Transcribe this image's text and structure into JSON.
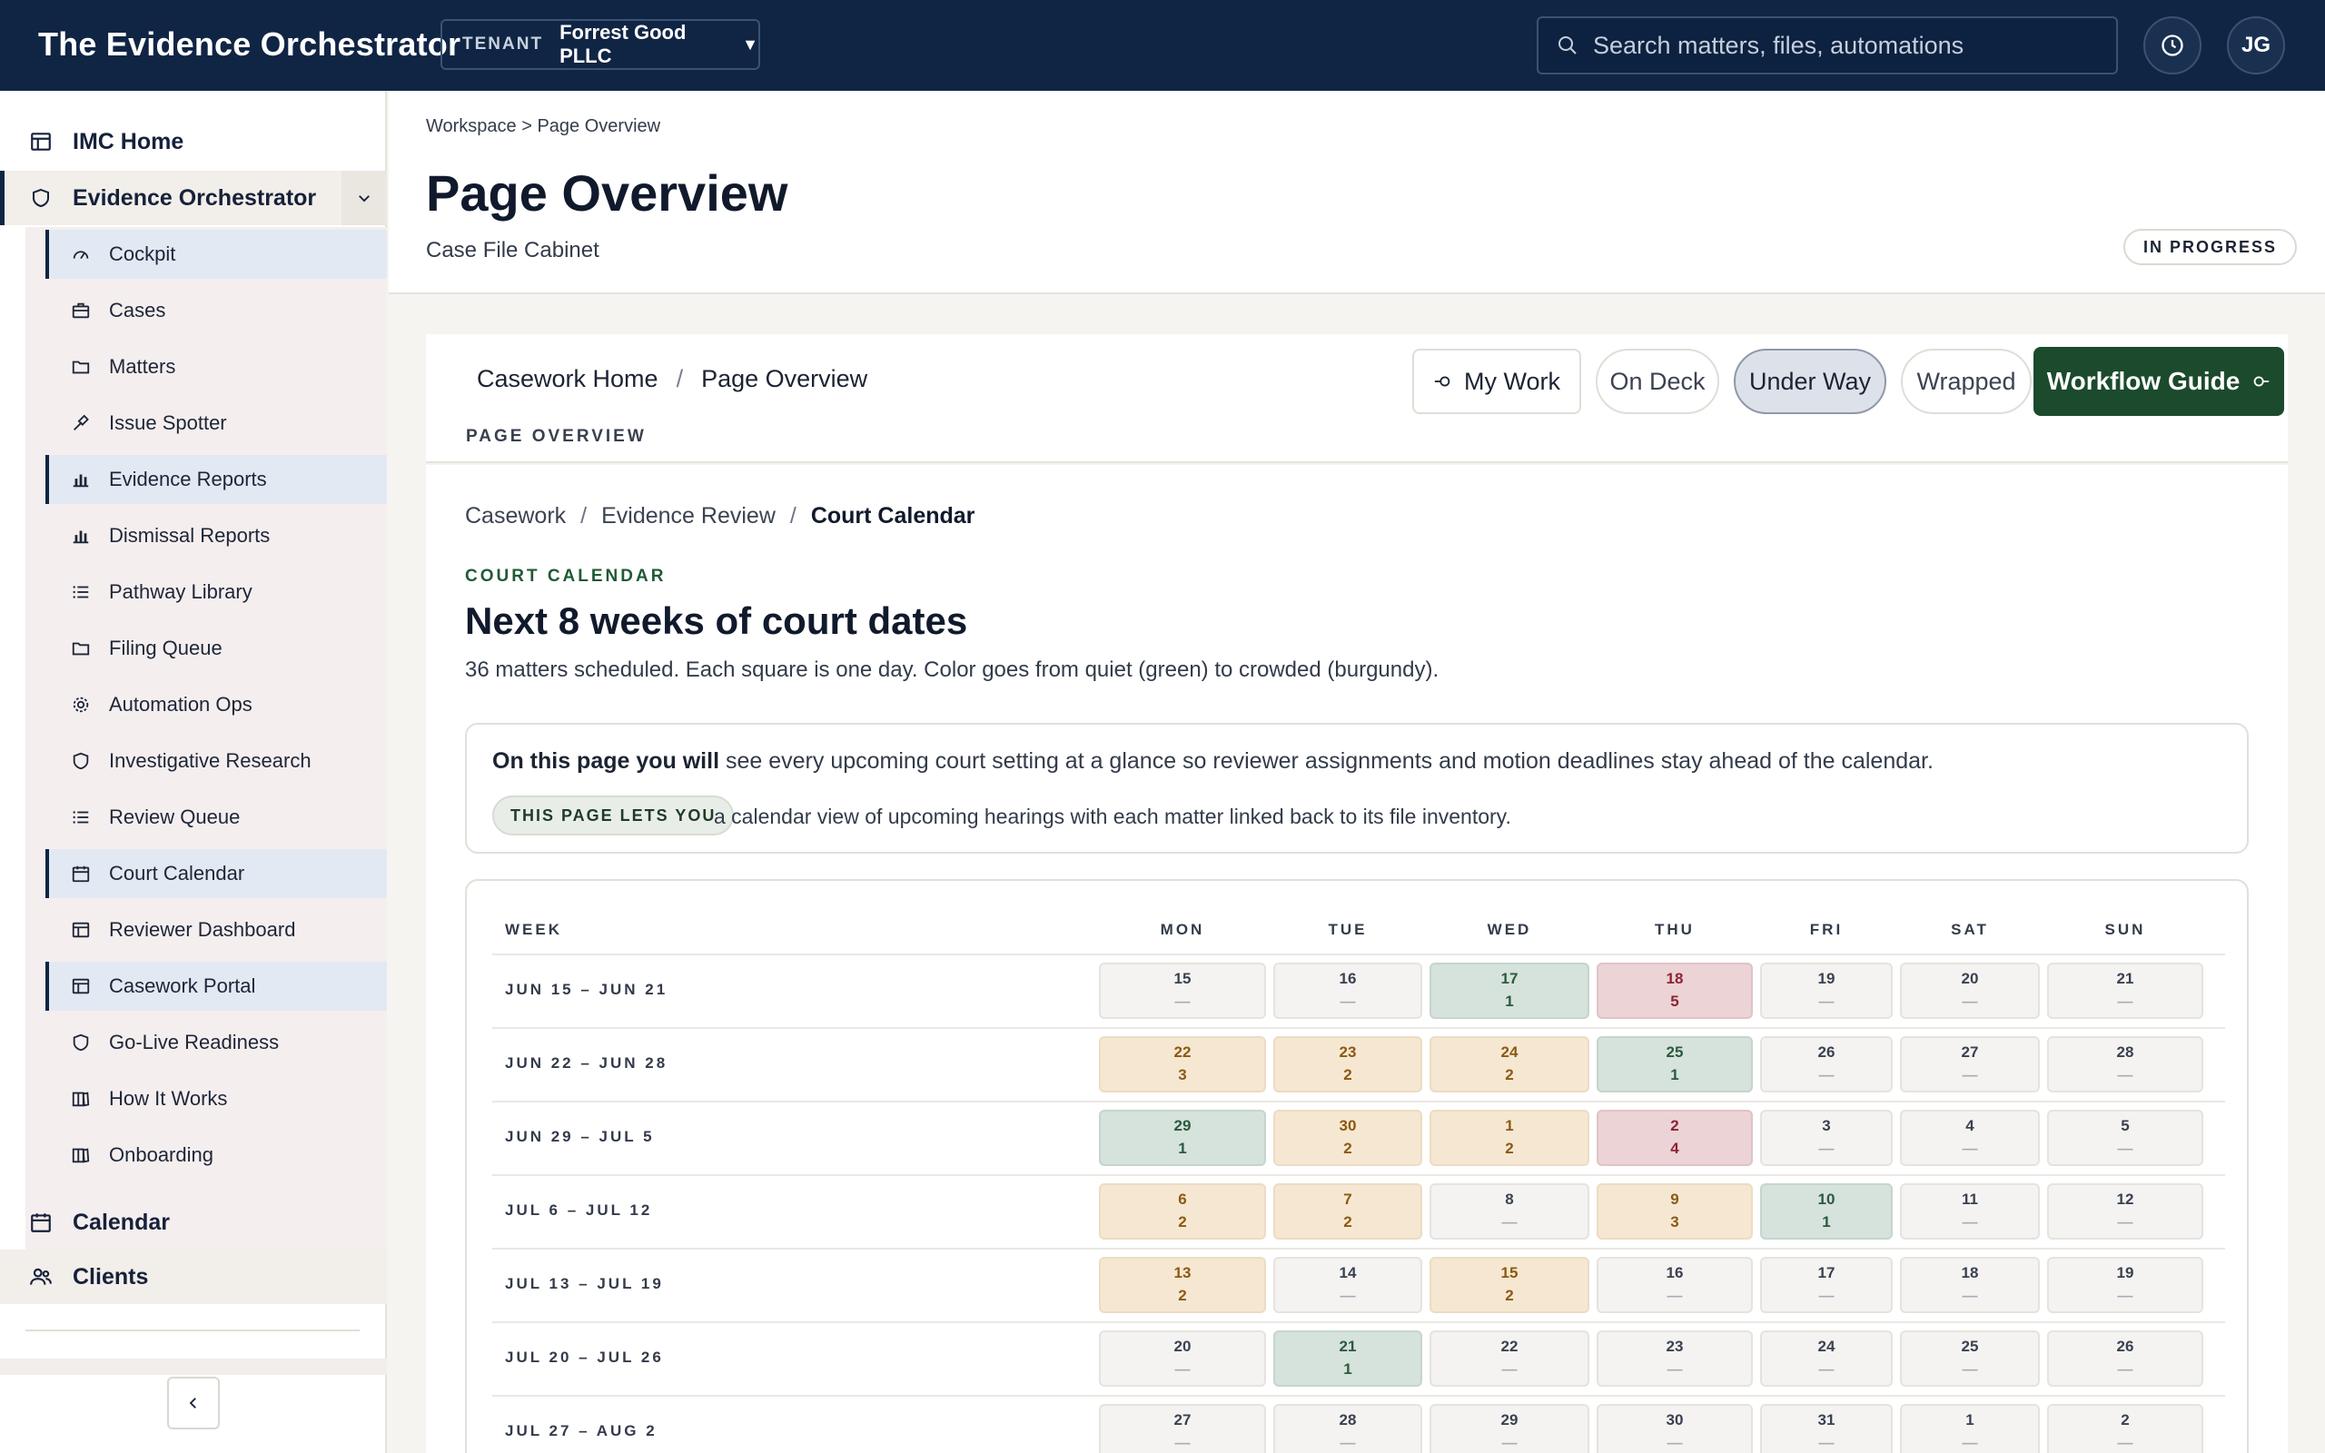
{
  "topbar": {
    "brand": "The Evidence Orchestrator",
    "tenant_label": "TENANT",
    "tenant_value": "Forrest Good PLLC",
    "search_placeholder": "Search matters, files, automations",
    "avatar_initials": "JG"
  },
  "sidebar": {
    "home": "IMC Home",
    "section": "Evidence Orchestrator",
    "items": [
      {
        "label": "Cockpit",
        "icon": "gauge-icon",
        "active": true
      },
      {
        "label": "Cases",
        "icon": "briefcase-icon",
        "active": false
      },
      {
        "label": "Matters",
        "icon": "folder-icon",
        "active": false
      },
      {
        "label": "Issue Spotter",
        "icon": "gavel-icon",
        "active": false
      },
      {
        "label": "Evidence Reports",
        "icon": "bar-chart-icon",
        "active": true
      },
      {
        "label": "Dismissal Reports",
        "icon": "bar-chart-icon",
        "active": false
      },
      {
        "label": "Pathway Library",
        "icon": "list-icon",
        "active": false
      },
      {
        "label": "Filing Queue",
        "icon": "folder-icon",
        "active": false
      },
      {
        "label": "Automation Ops",
        "icon": "gear-icon",
        "active": false
      },
      {
        "label": "Investigative Research",
        "icon": "shield-icon",
        "active": false
      },
      {
        "label": "Review Queue",
        "icon": "list-icon",
        "active": false
      },
      {
        "label": "Court Calendar",
        "icon": "calendar-icon",
        "active": true
      },
      {
        "label": "Reviewer Dashboard",
        "icon": "layout-icon",
        "active": false
      },
      {
        "label": "Casework Portal",
        "icon": "layout-icon",
        "active": true
      },
      {
        "label": "Go-Live Readiness",
        "icon": "shield-icon",
        "active": false
      },
      {
        "label": "How It Works",
        "icon": "book-icon",
        "active": false
      },
      {
        "label": "Onboarding",
        "icon": "book-icon",
        "active": false
      }
    ],
    "calendar": "Calendar",
    "clients": "Clients"
  },
  "header": {
    "breadcrumb": "Workspace > Page Overview",
    "title": "Page Overview",
    "subtitle": "Case File Cabinet",
    "status": "IN PROGRESS"
  },
  "toolbar": {
    "crumb_home": "Casework Home",
    "crumb_sep": "/",
    "crumb_current": "Page Overview",
    "section_label": "PAGE OVERVIEW",
    "filters": {
      "my_work": "My Work",
      "on_deck": "On Deck",
      "under_way": "Under Way",
      "wrapped": "Wrapped"
    },
    "guide_button": "Workflow Guide"
  },
  "content": {
    "crumbs": [
      "Casework",
      "Evidence Review",
      "Court Calendar"
    ],
    "eyebrow": "COURT CALENDAR",
    "heading": "Next 8 weeks of court dates",
    "description": "36 matters scheduled. Each square is one day. Color goes from quiet (green) to crowded (burgundy).",
    "info": {
      "lead_bold": "On this page you will",
      "lead_rest": "see every upcoming court setting at a glance so reviewer assignments and motion deadlines stay ahead of the calendar.",
      "chip": "THIS PAGE LETS YOU",
      "detail": "a calendar view of upcoming hearings with each matter linked back to its file inventory."
    }
  },
  "calendar": {
    "week_header": "WEEK",
    "days": [
      "MON",
      "TUE",
      "WED",
      "THU",
      "FRI",
      "SAT",
      "SUN"
    ],
    "empty_mark": "—",
    "weeks": [
      {
        "label": "JUN 15 – JUN 21",
        "cells": [
          {
            "d": "15",
            "n": 0
          },
          {
            "d": "16",
            "n": 0
          },
          {
            "d": "17",
            "n": 1
          },
          {
            "d": "18",
            "n": 5
          },
          {
            "d": "19",
            "n": 0
          },
          {
            "d": "20",
            "n": 0
          },
          {
            "d": "21",
            "n": 0
          }
        ]
      },
      {
        "label": "JUN 22 – JUN 28",
        "cells": [
          {
            "d": "22",
            "n": 3
          },
          {
            "d": "23",
            "n": 2
          },
          {
            "d": "24",
            "n": 2
          },
          {
            "d": "25",
            "n": 1
          },
          {
            "d": "26",
            "n": 0
          },
          {
            "d": "27",
            "n": 0
          },
          {
            "d": "28",
            "n": 0
          }
        ]
      },
      {
        "label": "JUN 29 – JUL 5",
        "cells": [
          {
            "d": "29",
            "n": 1
          },
          {
            "d": "30",
            "n": 2
          },
          {
            "d": "1",
            "n": 2
          },
          {
            "d": "2",
            "n": 4
          },
          {
            "d": "3",
            "n": 0
          },
          {
            "d": "4",
            "n": 0
          },
          {
            "d": "5",
            "n": 0
          }
        ]
      },
      {
        "label": "JUL 6 – JUL 12",
        "cells": [
          {
            "d": "6",
            "n": 2
          },
          {
            "d": "7",
            "n": 2
          },
          {
            "d": "8",
            "n": 0
          },
          {
            "d": "9",
            "n": 3
          },
          {
            "d": "10",
            "n": 1
          },
          {
            "d": "11",
            "n": 0
          },
          {
            "d": "12",
            "n": 0
          }
        ]
      },
      {
        "label": "JUL 13 – JUL 19",
        "cells": [
          {
            "d": "13",
            "n": 2
          },
          {
            "d": "14",
            "n": 0
          },
          {
            "d": "15",
            "n": 2
          },
          {
            "d": "16",
            "n": 0
          },
          {
            "d": "17",
            "n": 0
          },
          {
            "d": "18",
            "n": 0
          },
          {
            "d": "19",
            "n": 0
          }
        ]
      },
      {
        "label": "JUL 20 – JUL 26",
        "cells": [
          {
            "d": "20",
            "n": 0
          },
          {
            "d": "21",
            "n": 1
          },
          {
            "d": "22",
            "n": 0
          },
          {
            "d": "23",
            "n": 0
          },
          {
            "d": "24",
            "n": 0
          },
          {
            "d": "25",
            "n": 0
          },
          {
            "d": "26",
            "n": 0
          }
        ]
      },
      {
        "label": "JUL 27 – AUG 2",
        "cells": [
          {
            "d": "27",
            "n": 0
          },
          {
            "d": "28",
            "n": 0
          },
          {
            "d": "29",
            "n": 0
          },
          {
            "d": "30",
            "n": 0
          },
          {
            "d": "31",
            "n": 0
          },
          {
            "d": "1",
            "n": 0
          },
          {
            "d": "2",
            "n": 0
          }
        ]
      }
    ]
  },
  "colors": {
    "topbar": "#102544",
    "accent_green": "#1b4a2c",
    "quiet": "#d6e2dc",
    "moderate": "#f6e7d2",
    "crowded": "#ecd3d6"
  }
}
